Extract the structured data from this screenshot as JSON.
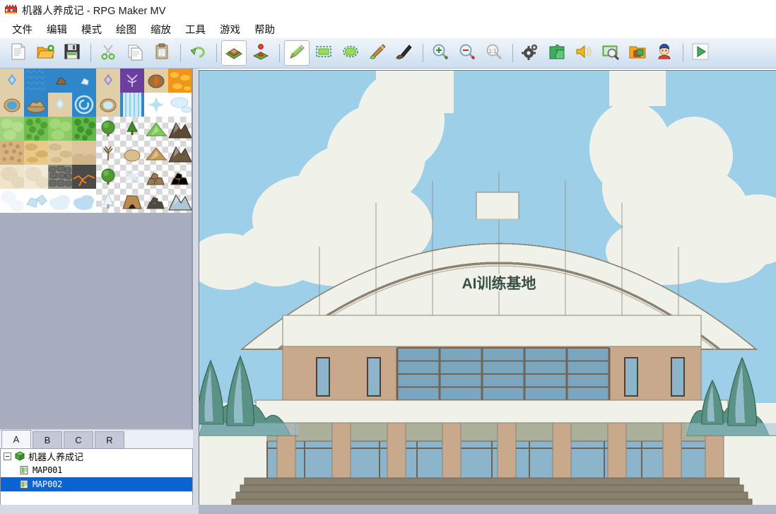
{
  "window": {
    "title": "机器人养成记 - RPG Maker MV",
    "app_icon": "rpgmaker-logo-icon"
  },
  "menubar": {
    "items": [
      {
        "label": "文件",
        "name": "menu-file"
      },
      {
        "label": "编辑",
        "name": "menu-edit"
      },
      {
        "label": "模式",
        "name": "menu-mode"
      },
      {
        "label": "绘图",
        "name": "menu-draw"
      },
      {
        "label": "缩放",
        "name": "menu-zoom"
      },
      {
        "label": "工具",
        "name": "menu-tools"
      },
      {
        "label": "游戏",
        "name": "menu-game"
      },
      {
        "label": "帮助",
        "name": "menu-help"
      }
    ]
  },
  "toolbar": {
    "buttons": [
      {
        "name": "new-project-button",
        "icon": "new-document-icon",
        "active": false
      },
      {
        "name": "open-project-button",
        "icon": "open-folder-icon",
        "active": false
      },
      {
        "name": "save-project-button",
        "icon": "save-floppy-icon",
        "active": false
      },
      {
        "sep": true
      },
      {
        "name": "cut-button",
        "icon": "scissors-icon",
        "active": false
      },
      {
        "name": "copy-button",
        "icon": "copy-pages-icon",
        "active": false
      },
      {
        "name": "paste-button",
        "icon": "clipboard-icon",
        "active": false
      },
      {
        "sep": true
      },
      {
        "name": "undo-button",
        "icon": "undo-arrow-icon",
        "active": false
      },
      {
        "sep": true
      },
      {
        "name": "map-mode-button",
        "icon": "map-layer-icon",
        "active": true
      },
      {
        "name": "event-mode-button",
        "icon": "event-pawn-icon",
        "active": false
      },
      {
        "sep": true
      },
      {
        "name": "pencil-tool-button",
        "icon": "pencil-icon",
        "active": true
      },
      {
        "name": "rectangle-tool-button",
        "icon": "rectangle-icon",
        "active": false
      },
      {
        "name": "ellipse-tool-button",
        "icon": "ellipse-icon",
        "active": false
      },
      {
        "name": "flood-fill-tool-button",
        "icon": "paint-brush-icon",
        "active": false
      },
      {
        "name": "shadow-pen-tool-button",
        "icon": "shadow-pen-icon",
        "active": false
      },
      {
        "sep": true
      },
      {
        "name": "zoom-in-button",
        "icon": "magnifier-plus-icon",
        "active": false
      },
      {
        "name": "zoom-out-button",
        "icon": "magnifier-minus-icon",
        "active": false
      },
      {
        "name": "zoom-actual-button",
        "icon": "magnifier-1to1-icon",
        "active": false
      },
      {
        "sep": true
      },
      {
        "name": "database-button",
        "icon": "gears-icon",
        "active": false
      },
      {
        "name": "plugin-manager-button",
        "icon": "puzzle-piece-icon",
        "active": false
      },
      {
        "name": "sound-test-button",
        "icon": "speaker-icon",
        "active": false
      },
      {
        "name": "event-searcher-button",
        "icon": "screen-search-icon",
        "active": false
      },
      {
        "name": "resource-manager-button",
        "icon": "resource-folder-icon",
        "active": false
      },
      {
        "name": "character-generator-button",
        "icon": "character-head-icon",
        "active": false
      },
      {
        "sep": true
      },
      {
        "name": "playtest-button",
        "icon": "play-triangle-icon",
        "active": false
      }
    ]
  },
  "tile_palette": {
    "columns": 8,
    "rows": 6,
    "tiles": [
      {
        "name": "tile-water-sparkle",
        "kind": "sand-gem",
        "bg": "#e0cfa8",
        "fg": "#5ca7d8"
      },
      {
        "name": "tile-deep-ocean",
        "kind": "ocean",
        "bg": "#2f86c8",
        "fg": "#3f97d6"
      },
      {
        "name": "tile-ocean-rock",
        "kind": "ocean-rock",
        "bg": "#2f86c8",
        "fg": "#8a6a42"
      },
      {
        "name": "tile-ocean-ice",
        "kind": "ocean-ice",
        "bg": "#2f86c8",
        "fg": "#dff0fa"
      },
      {
        "name": "tile-sand-gem2",
        "kind": "sand-gem",
        "bg": "#e0cfa8",
        "fg": "#9a7fbe"
      },
      {
        "name": "tile-poison-swamp",
        "kind": "swamp",
        "bg": "#6b3f9e",
        "fg": "#d8c8ee"
      },
      {
        "name": "tile-lava-hole",
        "kind": "lava-hole",
        "bg": "#e0cfa8",
        "fg": "#e06a18"
      },
      {
        "name": "tile-lava",
        "kind": "lava",
        "bg": "#f0941a",
        "fg": "#ffd24a"
      },
      {
        "name": "tile-oasis-pond",
        "kind": "pond",
        "bg": "#e0cfa8",
        "fg": "#4fa3d6"
      },
      {
        "name": "tile-ocean-island",
        "kind": "ocean-island",
        "bg": "#2f86c8",
        "fg": "#b99a6c"
      },
      {
        "name": "tile-sand-crystal",
        "kind": "sand-gem",
        "bg": "#e0cfa8",
        "fg": "#bfe6f8"
      },
      {
        "name": "tile-whirlpool",
        "kind": "whirlpool",
        "bg": "#2f86c8",
        "fg": "#bfe6f8"
      },
      {
        "name": "tile-sand-well",
        "kind": "pond",
        "bg": "#e0cfa8",
        "fg": "#cfe8f6"
      },
      {
        "name": "tile-waterfall",
        "kind": "waterfall",
        "bg": "#2f86c8",
        "fg": "#cfeaf8"
      },
      {
        "name": "tile-ice-sparkle",
        "kind": "ice-sparkle",
        "bg": "#ffffff",
        "fg": "#b8dff2"
      },
      {
        "name": "tile-snow-mound",
        "kind": "snow-mound",
        "bg": "#ffffff",
        "fg": "#dbeefb"
      },
      {
        "name": "tile-grass-light",
        "kind": "grass",
        "bg": "#9ed37a",
        "fg": "#b9e292"
      },
      {
        "name": "tile-grass-medium",
        "kind": "grass-rough",
        "bg": "#6fc04e",
        "fg": "#4f9a34"
      },
      {
        "name": "tile-grass-plain",
        "kind": "grass",
        "bg": "#8ccc62",
        "fg": "#a7dd80"
      },
      {
        "name": "tile-grass-dark",
        "kind": "grass-rough",
        "bg": "#5fbb48",
        "fg": "#3f8c2c"
      },
      {
        "name": "tile-tree-round",
        "kind": "tree",
        "bg": "checker",
        "fg": "#4f9a34"
      },
      {
        "name": "tile-bush-small",
        "kind": "bush",
        "bg": "checker",
        "fg": "#3f8c2c"
      },
      {
        "name": "tile-grass-hill",
        "kind": "hill-green",
        "bg": "checker",
        "fg": "#7dc95a"
      },
      {
        "name": "tile-mountain-dark",
        "kind": "mountain",
        "bg": "checker",
        "fg": "#5d4b38"
      },
      {
        "name": "tile-gravel",
        "kind": "gravel",
        "bg": "#d6b480",
        "fg": "#b88f56"
      },
      {
        "name": "tile-desert-sand",
        "kind": "desert",
        "bg": "#e8c98a",
        "fg": "#d0a65e"
      },
      {
        "name": "tile-sand-plain",
        "kind": "desert",
        "bg": "#e4cfa4",
        "fg": "#cdb384"
      },
      {
        "name": "tile-sand-dune",
        "kind": "dune",
        "bg": "#ddc49c",
        "fg": "#c9ad80"
      },
      {
        "name": "tile-dead-tree",
        "kind": "dead-tree",
        "bg": "checker",
        "fg": "#7a6342"
      },
      {
        "name": "tile-sand-mound",
        "kind": "sand-mound",
        "bg": "checker",
        "fg": "#d9bd8c"
      },
      {
        "name": "tile-sand-hill",
        "kind": "hill-sand",
        "bg": "checker",
        "fg": "#c49a5e"
      },
      {
        "name": "tile-mountain-brown",
        "kind": "mountain",
        "bg": "checker",
        "fg": "#6b5a42"
      },
      {
        "name": "tile-pale-sand",
        "kind": "pale",
        "bg": "#efe5cf",
        "fg": "#e2d4b8"
      },
      {
        "name": "tile-pale-sand2",
        "kind": "pale",
        "bg": "#f2ead8",
        "fg": "#e6dabf"
      },
      {
        "name": "tile-cobblestone",
        "kind": "cobble",
        "bg": "#8a8a84",
        "fg": "#6c6c66"
      },
      {
        "name": "tile-lava-cracks",
        "kind": "lava-crack",
        "bg": "#4a4a46",
        "fg": "#ef7a22"
      },
      {
        "name": "tile-tree-green",
        "kind": "tree",
        "bg": "checker",
        "fg": "#4f9a34"
      },
      {
        "name": "tile-ice-crystal",
        "kind": "ice-crystal",
        "bg": "checker",
        "fg": "#dcecf6"
      },
      {
        "name": "tile-rock-pile",
        "kind": "rock-pile",
        "bg": "checker",
        "fg": "#9a7a4e"
      },
      {
        "name": "tile-gold-rocks",
        "kind": "rock-pile",
        "bg": "checker",
        "fg": "#c8a martin"
      },
      {
        "name": "tile-snow-plain",
        "kind": "snow",
        "bg": "#ffffff",
        "fg": "#f0f6fb"
      },
      {
        "name": "tile-ice-floe",
        "kind": "ice-floe",
        "bg": "#ffffff",
        "fg": "#c6e3f4"
      },
      {
        "name": "tile-cloud-white",
        "kind": "cloud",
        "bg": "#ffffff",
        "fg": "#e2f0fa"
      },
      {
        "name": "tile-cloud-blue",
        "kind": "cloud",
        "bg": "#ffffff",
        "fg": "#bcdcf2"
      },
      {
        "name": "tile-snow-tree",
        "kind": "snow-tree",
        "bg": "checker",
        "fg": "#e8f3fa"
      },
      {
        "name": "tile-cave-entrance",
        "kind": "cave",
        "bg": "checker",
        "fg": "#3a3028"
      },
      {
        "name": "tile-dark-rocks",
        "kind": "rock-pile",
        "bg": "checker",
        "fg": "#4a4a48"
      },
      {
        "name": "tile-snow-mountain",
        "kind": "mountain",
        "bg": "checker",
        "fg": "#aec6dc"
      }
    ]
  },
  "tileset_tabs": {
    "items": [
      {
        "label": "A",
        "name": "tileset-tab-a",
        "selected": true
      },
      {
        "label": "B",
        "name": "tileset-tab-b",
        "selected": false
      },
      {
        "label": "C",
        "name": "tileset-tab-c",
        "selected": false
      },
      {
        "label": "R",
        "name": "tileset-tab-r",
        "selected": false
      }
    ]
  },
  "map_tree": {
    "project": {
      "label": "机器人养成记",
      "icon": "project-cube-icon"
    },
    "maps": [
      {
        "label": "MAP001",
        "name": "map-tree-item-map001",
        "selected": false
      },
      {
        "label": "MAP002",
        "name": "map-tree-item-map002",
        "selected": true
      }
    ]
  },
  "map_canvas": {
    "sign_text": "AI训练基地",
    "colors": {
      "sky": "#9dd0e8",
      "cloud": "#f0f2ea",
      "building_wall": "#f0f2ea",
      "outline": "#8d8373",
      "brick_tan": "#c8a98c",
      "glass_blue": "#8cb4ca",
      "glass_dark": "#7ba6bf",
      "mullion": "#6f6455",
      "tree_green": "#5a9386",
      "tree_blue": "#9dc2d4",
      "step_brown": "#8a8070",
      "sign_text_color": "#3a4f46",
      "band_olive": "#aab09a"
    }
  }
}
